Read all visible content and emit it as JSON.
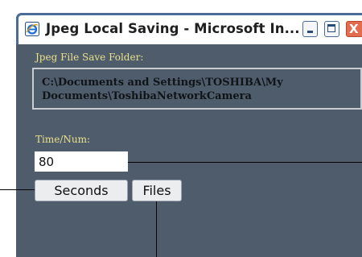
{
  "window": {
    "title": "Jpeg Local Saving - Microsoft In...",
    "icon": "internet-explorer-icon",
    "controls": {
      "minimize": "minimize-icon",
      "maximize": "maximize-icon",
      "close": "close-icon",
      "close_glyph": "X"
    }
  },
  "folder": {
    "label": "Jpeg File Save Folder:",
    "path": "C:\\Documents and Settings\\TOSHIBA\\My Documents\\ToshibaNetworkCamera"
  },
  "time": {
    "label": "Time/Num:",
    "value": "80"
  },
  "buttons": {
    "seconds": "Seconds",
    "files": "Files"
  },
  "colors": {
    "client_background": "#4f5c6b",
    "label_text": "#e8e08a",
    "title_border": "#4b6c97",
    "close_button": "#e36b4e"
  }
}
